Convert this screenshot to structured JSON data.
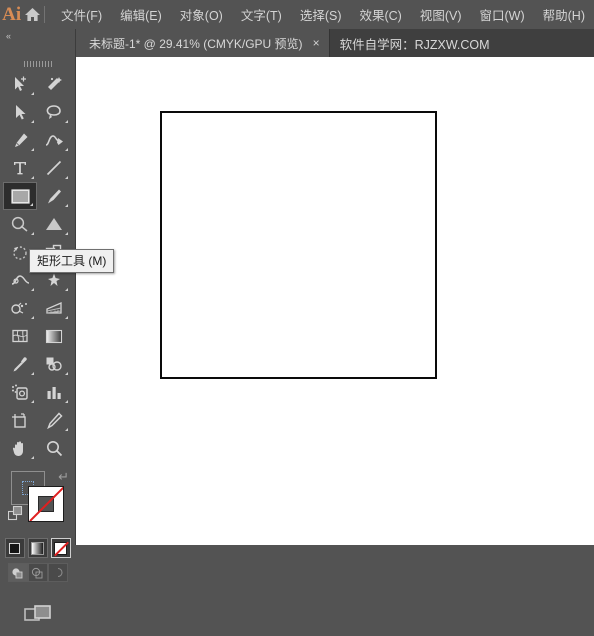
{
  "app": {
    "logo_text": "Ai",
    "home_icon": "home-icon"
  },
  "menubar": {
    "items": [
      {
        "label": "文件(F)",
        "name": "menu-file"
      },
      {
        "label": "编辑(E)",
        "name": "menu-edit"
      },
      {
        "label": "对象(O)",
        "name": "menu-object"
      },
      {
        "label": "文字(T)",
        "name": "menu-type"
      },
      {
        "label": "选择(S)",
        "name": "menu-select"
      },
      {
        "label": "效果(C)",
        "name": "menu-effect"
      },
      {
        "label": "视图(V)",
        "name": "menu-view"
      },
      {
        "label": "窗口(W)",
        "name": "menu-window"
      },
      {
        "label": "帮助(H)",
        "name": "menu-help"
      }
    ]
  },
  "tabbar": {
    "collapse_label": "«",
    "document_tab": {
      "title": "未标题-1* @ 29.41% (CMYK/GPU 预览)",
      "close_label": "×"
    },
    "note": "软件自学网：RJZXW.COM"
  },
  "toolbar": {
    "tooltip": "矩形工具 (M)",
    "selected_tool": "rectangle-tool",
    "tools": [
      {
        "name": "selection-tool",
        "label": "选择工具"
      },
      {
        "name": "magic-wand-tool",
        "label": "魔棒工具"
      },
      {
        "name": "direct-selection-tool",
        "label": "直接选择工具"
      },
      {
        "name": "lasso-tool",
        "label": "套索工具"
      },
      {
        "name": "pen-tool",
        "label": "钢笔工具"
      },
      {
        "name": "curvature-tool",
        "label": "曲率工具"
      },
      {
        "name": "type-tool",
        "label": "文字工具"
      },
      {
        "name": "line-segment-tool",
        "label": "直线段工具"
      },
      {
        "name": "rectangle-tool",
        "label": "矩形工具"
      },
      {
        "name": "paintbrush-tool",
        "label": "画笔工具"
      },
      {
        "name": "shaper-tool",
        "label": "Shaper 工具"
      },
      {
        "name": "gradient-mesh-tool",
        "label": "渐变网格工具"
      },
      {
        "name": "rotate-tool",
        "label": "旋转工具"
      },
      {
        "name": "shape-builder-tool",
        "label": "形状生成器工具"
      },
      {
        "name": "width-tool",
        "label": "宽度工具"
      },
      {
        "name": "free-transform-tool",
        "label": "自由变换工具"
      },
      {
        "name": "perspective-grid-tool",
        "label": "透视网格工具"
      },
      {
        "name": "symbol-sprayer-tool",
        "label": "符号喷枪工具"
      },
      {
        "name": "mesh-tool",
        "label": "网格工具"
      },
      {
        "name": "gradient-tool",
        "label": "渐变工具"
      },
      {
        "name": "eyedropper-tool",
        "label": "吸管工具"
      },
      {
        "name": "blend-tool",
        "label": "混合工具"
      },
      {
        "name": "live-paint-bucket-tool",
        "label": "实时上色工具"
      },
      {
        "name": "column-graph-tool",
        "label": "柱形图工具"
      },
      {
        "name": "artboard-tool",
        "label": "画板工具"
      },
      {
        "name": "slice-tool",
        "label": "切片工具"
      },
      {
        "name": "hand-tool",
        "label": "抓手工具"
      },
      {
        "name": "zoom-tool",
        "label": "缩放工具"
      }
    ],
    "color_controls": {
      "fill_swatch": "none",
      "stroke_swatch": "none",
      "swap_icon": "swap-fill-stroke-icon",
      "default_icon": "default-fill-stroke-icon",
      "mode_buttons": [
        {
          "name": "color-mode-button",
          "label": "颜色",
          "active": false
        },
        {
          "name": "gradient-mode-button",
          "label": "渐变",
          "active": false
        },
        {
          "name": "none-mode-button",
          "label": "无",
          "active": true
        }
      ],
      "draw_mode_buttons": [
        {
          "name": "draw-normal-button",
          "label": "正常绘图",
          "active": true
        },
        {
          "name": "draw-behind-button",
          "label": "背面绘图",
          "active": false
        },
        {
          "name": "draw-inside-button",
          "label": "内部绘图",
          "active": false
        }
      ],
      "screen_mode_button": {
        "name": "change-screen-mode-button",
        "label": "更改屏幕模式"
      }
    }
  },
  "canvas": {
    "artboard": {
      "name": "artboard-rectangle",
      "zoom": "29.41%",
      "color_mode": "CMYK",
      "border_color": "#0a0a0a",
      "fill_color": "#ffffff"
    },
    "background_color": "#ffffff"
  },
  "colors": {
    "chrome": "#535353",
    "chrome_dark": "#3f3f3f",
    "accent": "#d88c54",
    "text": "#d4d4d4",
    "none_red": "#e02020"
  }
}
